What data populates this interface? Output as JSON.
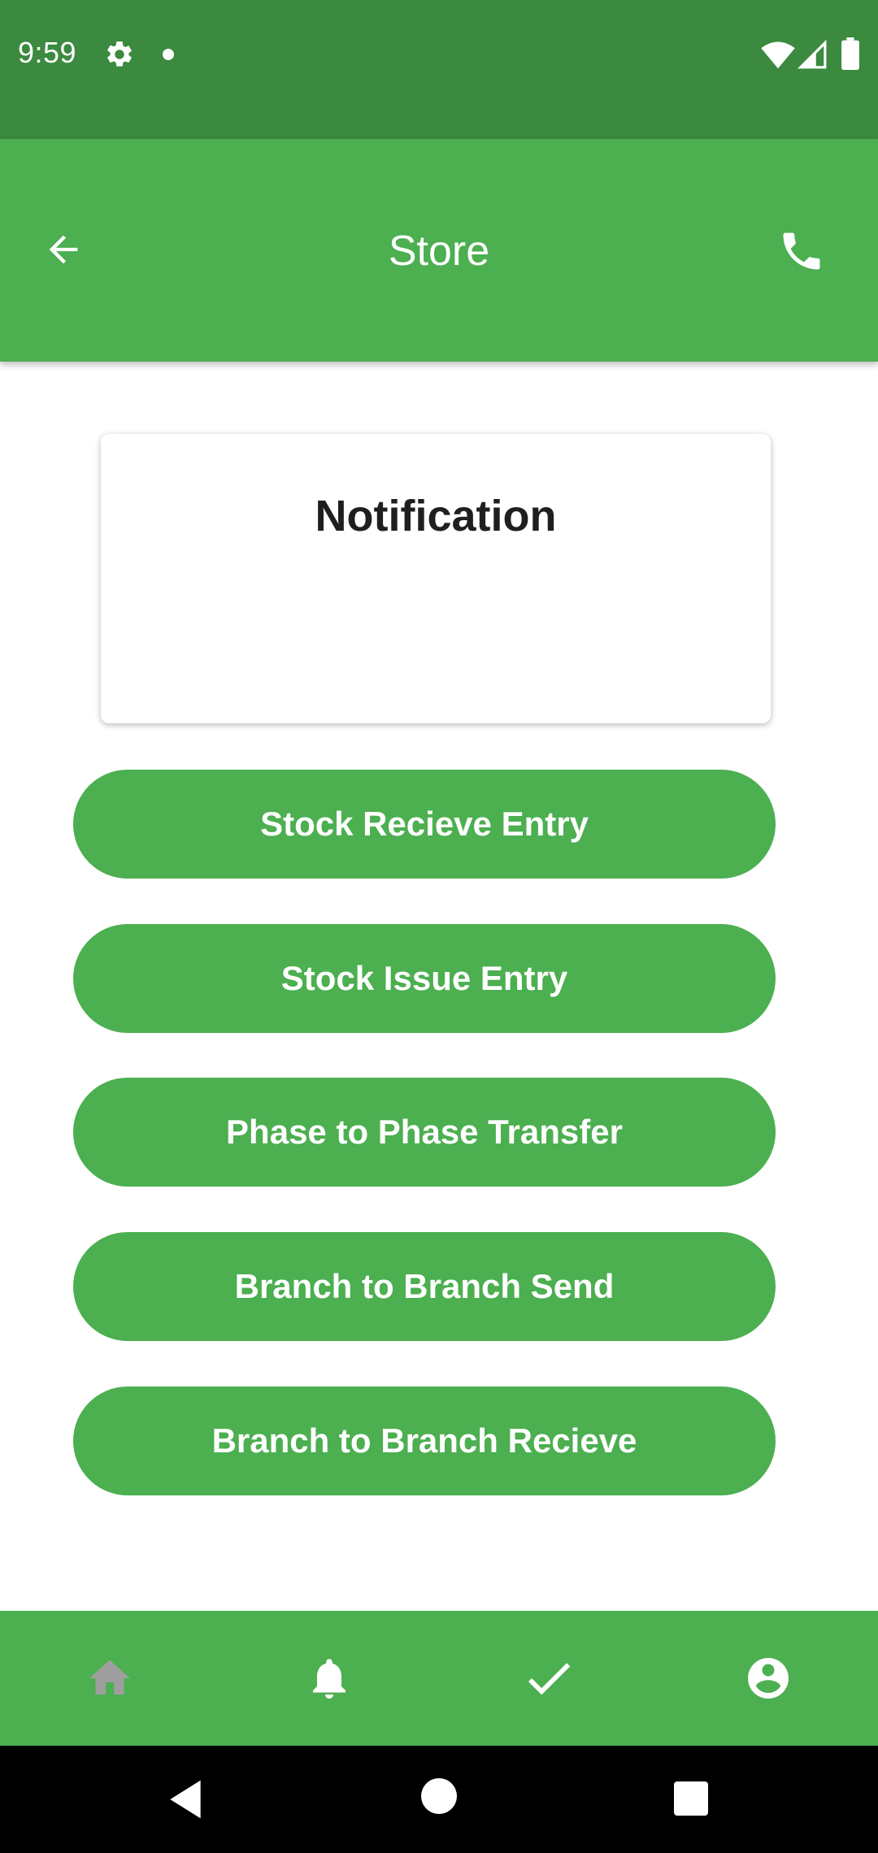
{
  "status_bar": {
    "time": "9:59",
    "icons": [
      "gear-icon",
      "dot-icon",
      "wifi-icon",
      "signal-icon",
      "battery-icon"
    ]
  },
  "app_bar": {
    "title": "Store",
    "back_icon": "arrow-back-icon",
    "action_icon": "phone-icon"
  },
  "notification_card": {
    "title": "Notification"
  },
  "actions": [
    {
      "label": "Stock Recieve Entry"
    },
    {
      "label": "Stock Issue Entry"
    },
    {
      "label": "Phase to Phase Transfer"
    },
    {
      "label": "Branch to Branch Send"
    },
    {
      "label": "Branch to Branch Recieve"
    }
  ],
  "bottom_nav": {
    "items": [
      "home-icon",
      "bell-icon",
      "check-icon",
      "account-icon"
    ],
    "selected": "home-icon"
  },
  "colors": {
    "status_bar": "#3b8a3f",
    "primary": "#4caf50",
    "home_icon_inactive": "#9e9e9e"
  }
}
